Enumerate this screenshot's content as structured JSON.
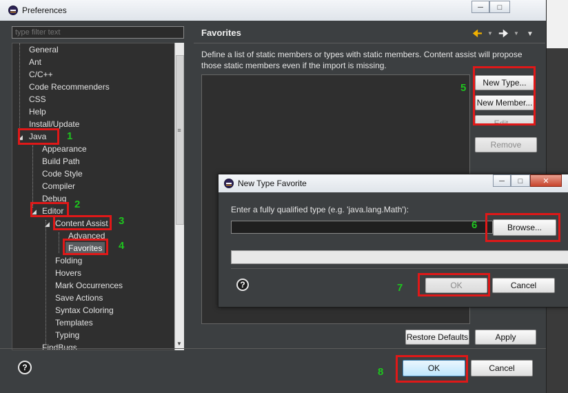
{
  "window": {
    "title": "Preferences",
    "controls": [
      "minimize-icon",
      "maximize-icon"
    ]
  },
  "filter": {
    "placeholder": "type filter text"
  },
  "tree": {
    "items": [
      {
        "label": "General",
        "level": 0
      },
      {
        "label": "Ant",
        "level": 0
      },
      {
        "label": "C/C++",
        "level": 0
      },
      {
        "label": "Code Recommenders",
        "level": 0
      },
      {
        "label": "CSS",
        "level": 0
      },
      {
        "label": "Help",
        "level": 0
      },
      {
        "label": "Install/Update",
        "level": 0
      },
      {
        "label": "Java",
        "level": 0
      },
      {
        "label": "Appearance",
        "level": 1
      },
      {
        "label": "Build Path",
        "level": 1
      },
      {
        "label": "Code Style",
        "level": 1
      },
      {
        "label": "Compiler",
        "level": 1
      },
      {
        "label": "Debug",
        "level": 1
      },
      {
        "label": "Editor",
        "level": 1
      },
      {
        "label": "Content Assist",
        "level": 2
      },
      {
        "label": "Advanced",
        "level": 3
      },
      {
        "label": "Favorites",
        "level": 3
      },
      {
        "label": "Folding",
        "level": 2
      },
      {
        "label": "Hovers",
        "level": 2
      },
      {
        "label": "Mark Occurrences",
        "level": 2
      },
      {
        "label": "Save Actions",
        "level": 2
      },
      {
        "label": "Syntax Coloring",
        "level": 2
      },
      {
        "label": "Templates",
        "level": 2
      },
      {
        "label": "Typing",
        "level": 2
      },
      {
        "label": "FindBugs",
        "level": 1
      }
    ],
    "selected": "Favorites"
  },
  "page": {
    "title": "Favorites",
    "description": "Define a list of static members or types with static members. Content assist will propose those static members even if the import is missing.",
    "buttons": {
      "new_type": "New Type...",
      "new_member": "New Member...",
      "edit": "Edit...",
      "remove": "Remove"
    },
    "restore_defaults": "Restore Defaults",
    "apply": "Apply"
  },
  "footer": {
    "ok": "OK",
    "cancel": "Cancel"
  },
  "dialog": {
    "title": "New Type Favorite",
    "label": "Enter a fully qualified type (e.g. 'java.lang.Math'):",
    "input_value": "",
    "browse": "Browse...",
    "ok": "OK",
    "cancel": "Cancel"
  },
  "annotations": [
    "1",
    "2",
    "3",
    "4",
    "5",
    "6",
    "7",
    "8"
  ],
  "colors": {
    "annotation_box": "#e01818",
    "annotation_number": "#1ec51e",
    "background": "#3c3f41"
  }
}
